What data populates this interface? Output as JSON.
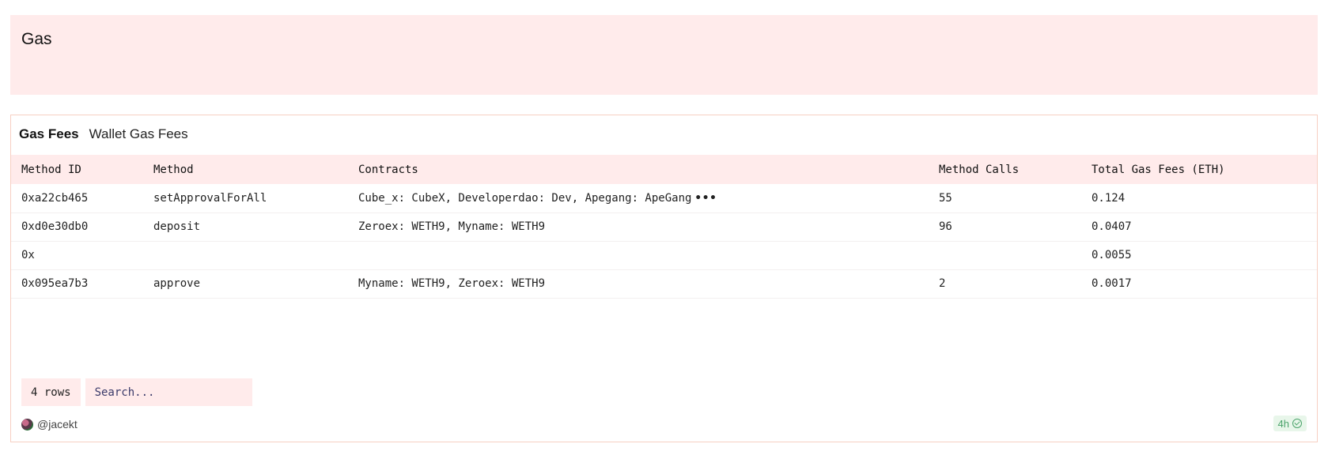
{
  "header": {
    "title": "Gas"
  },
  "tabs": [
    {
      "label": "Gas Fees",
      "active": true
    },
    {
      "label": "Wallet Gas Fees",
      "active": false
    }
  ],
  "table": {
    "columns": [
      "Method ID",
      "Method",
      "Contracts",
      "Method Calls",
      "Total Gas Fees (ETH)"
    ],
    "rows": [
      {
        "method_id": "0xa22cb465",
        "method": "setApprovalForAll",
        "contracts": "Cube_x: CubeX, Developerdao: Dev, Apegang: ApeGang",
        "truncated": "•••",
        "method_calls": "55",
        "total_gas_fees": "0.124"
      },
      {
        "method_id": "0xd0e30db0",
        "method": "deposit",
        "contracts": "Zeroex: WETH9, Myname: WETH9",
        "truncated": "",
        "method_calls": "96",
        "total_gas_fees": "0.0407"
      },
      {
        "method_id": "0x",
        "method": "",
        "contracts": "",
        "truncated": "",
        "method_calls": "",
        "total_gas_fees": "0.0055"
      },
      {
        "method_id": "0x095ea7b3",
        "method": "approve",
        "contracts": "Myname: WETH9, Zeroex: WETH9",
        "truncated": "",
        "method_calls": "2",
        "total_gas_fees": "0.0017"
      }
    ]
  },
  "controls": {
    "row_count": "4 rows",
    "search_placeholder": "Search..."
  },
  "footer": {
    "author": "@jacekt",
    "freshness": "4h"
  },
  "colors": {
    "header_bg": "#ffebeb",
    "panel_border": "#f7cfc2",
    "badge_green": "#4aa36a"
  }
}
